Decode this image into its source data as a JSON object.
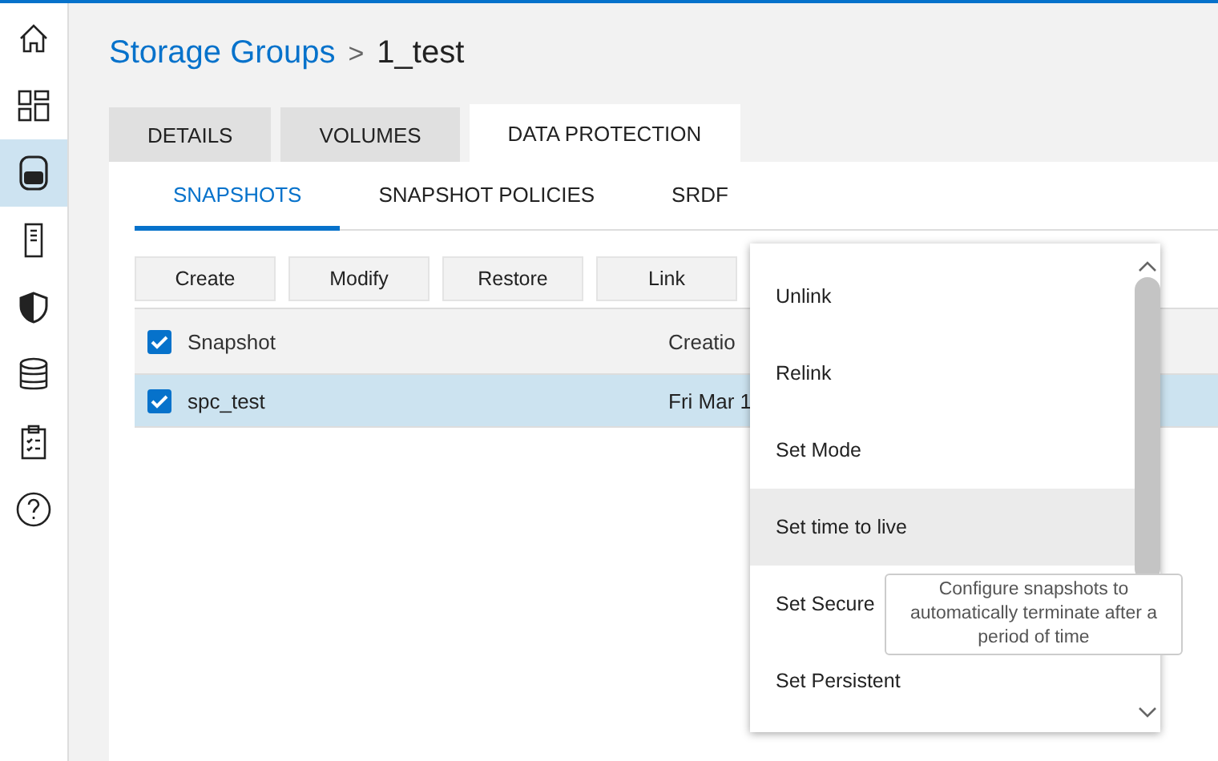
{
  "sidebar": {
    "items": [
      {
        "selected": false
      },
      {
        "selected": false
      },
      {
        "selected": true
      },
      {
        "selected": false
      },
      {
        "selected": false
      },
      {
        "selected": false
      },
      {
        "selected": false
      },
      {
        "selected": false
      }
    ]
  },
  "breadcrumb": {
    "parent": "Storage Groups",
    "separator": ">",
    "current": "1_test"
  },
  "tabs": [
    {
      "label": "DETAILS",
      "selected": false
    },
    {
      "label": "VOLUMES",
      "selected": false
    },
    {
      "label": "DATA PROTECTION",
      "selected": true
    }
  ],
  "subtabs": [
    {
      "label": "SNAPSHOTS",
      "selected": true
    },
    {
      "label": "SNAPSHOT POLICIES",
      "selected": false
    },
    {
      "label": "SRDF",
      "selected": false
    }
  ],
  "toolbar": {
    "buttons": [
      "Create",
      "Modify",
      "Restore",
      "Link"
    ]
  },
  "table": {
    "columns": [
      {
        "label": "Snapshot",
        "checked": true
      },
      {
        "label": "Creatio"
      }
    ],
    "rows": [
      {
        "cells": [
          "spc_test",
          "Fri Mar 1"
        ],
        "checked": true,
        "selected": true
      }
    ]
  },
  "menu": {
    "items": [
      {
        "label": "Unlink",
        "selected": false
      },
      {
        "label": "Relink",
        "selected": false
      },
      {
        "label": "Set Mode",
        "selected": false
      },
      {
        "label": "Set time to live",
        "selected": true
      },
      {
        "label": "Set Secure",
        "selected": false
      },
      {
        "label": "Set Persistent",
        "selected": false
      }
    ]
  },
  "tooltip": {
    "text": "Configure snapshots to automatically terminate after a period of time"
  }
}
